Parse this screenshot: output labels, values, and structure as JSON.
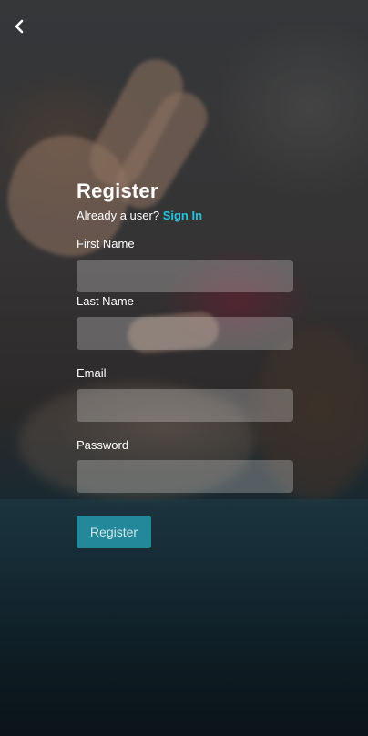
{
  "nav": {
    "back_icon": "chevron-left-icon"
  },
  "register": {
    "title": "Register",
    "subtitle_prefix": "Already a user?",
    "sign_in_link": "Sign In",
    "fields": {
      "first_name": {
        "label": "First Name",
        "value": "",
        "placeholder": ""
      },
      "last_name": {
        "label": "Last Name",
        "value": "",
        "placeholder": ""
      },
      "email": {
        "label": "Email",
        "value": "",
        "placeholder": ""
      },
      "password": {
        "label": "Password",
        "value": "",
        "placeholder": ""
      }
    },
    "submit_label": "Register"
  },
  "colors": {
    "accent_link": "#25c4e0",
    "button_bg": "#23899a",
    "field_bg": "rgba(255,255,255,0.25)"
  }
}
